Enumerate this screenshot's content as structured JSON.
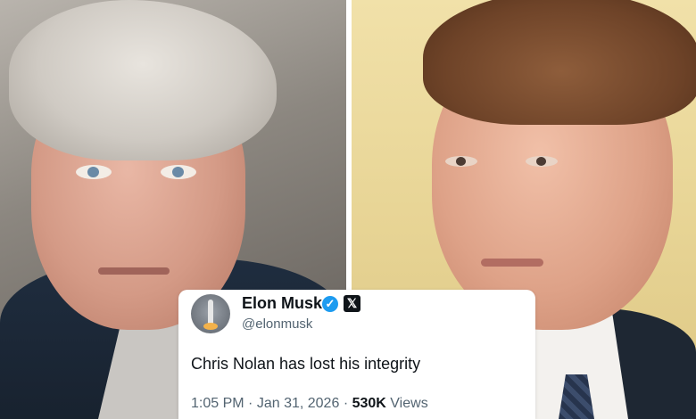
{
  "photos": {
    "left": {
      "subject": "man-gray-hair-photo"
    },
    "right": {
      "subject": "man-brown-hair-photo"
    }
  },
  "tweet": {
    "display_name": "Elon Musk",
    "handle": "@elonmusk",
    "verified_icon": "verified-badge-icon",
    "platform_icon": "x-logo-icon",
    "text": "Chris Nolan has lost his integrity",
    "time": "1:05 PM",
    "separator": "·",
    "date": "Jan 31, 2026",
    "views_count": "530K",
    "views_label": "Views"
  },
  "colors": {
    "verified_blue": "#1d9bf0",
    "text_primary": "#0f1419",
    "text_secondary": "#536471"
  }
}
